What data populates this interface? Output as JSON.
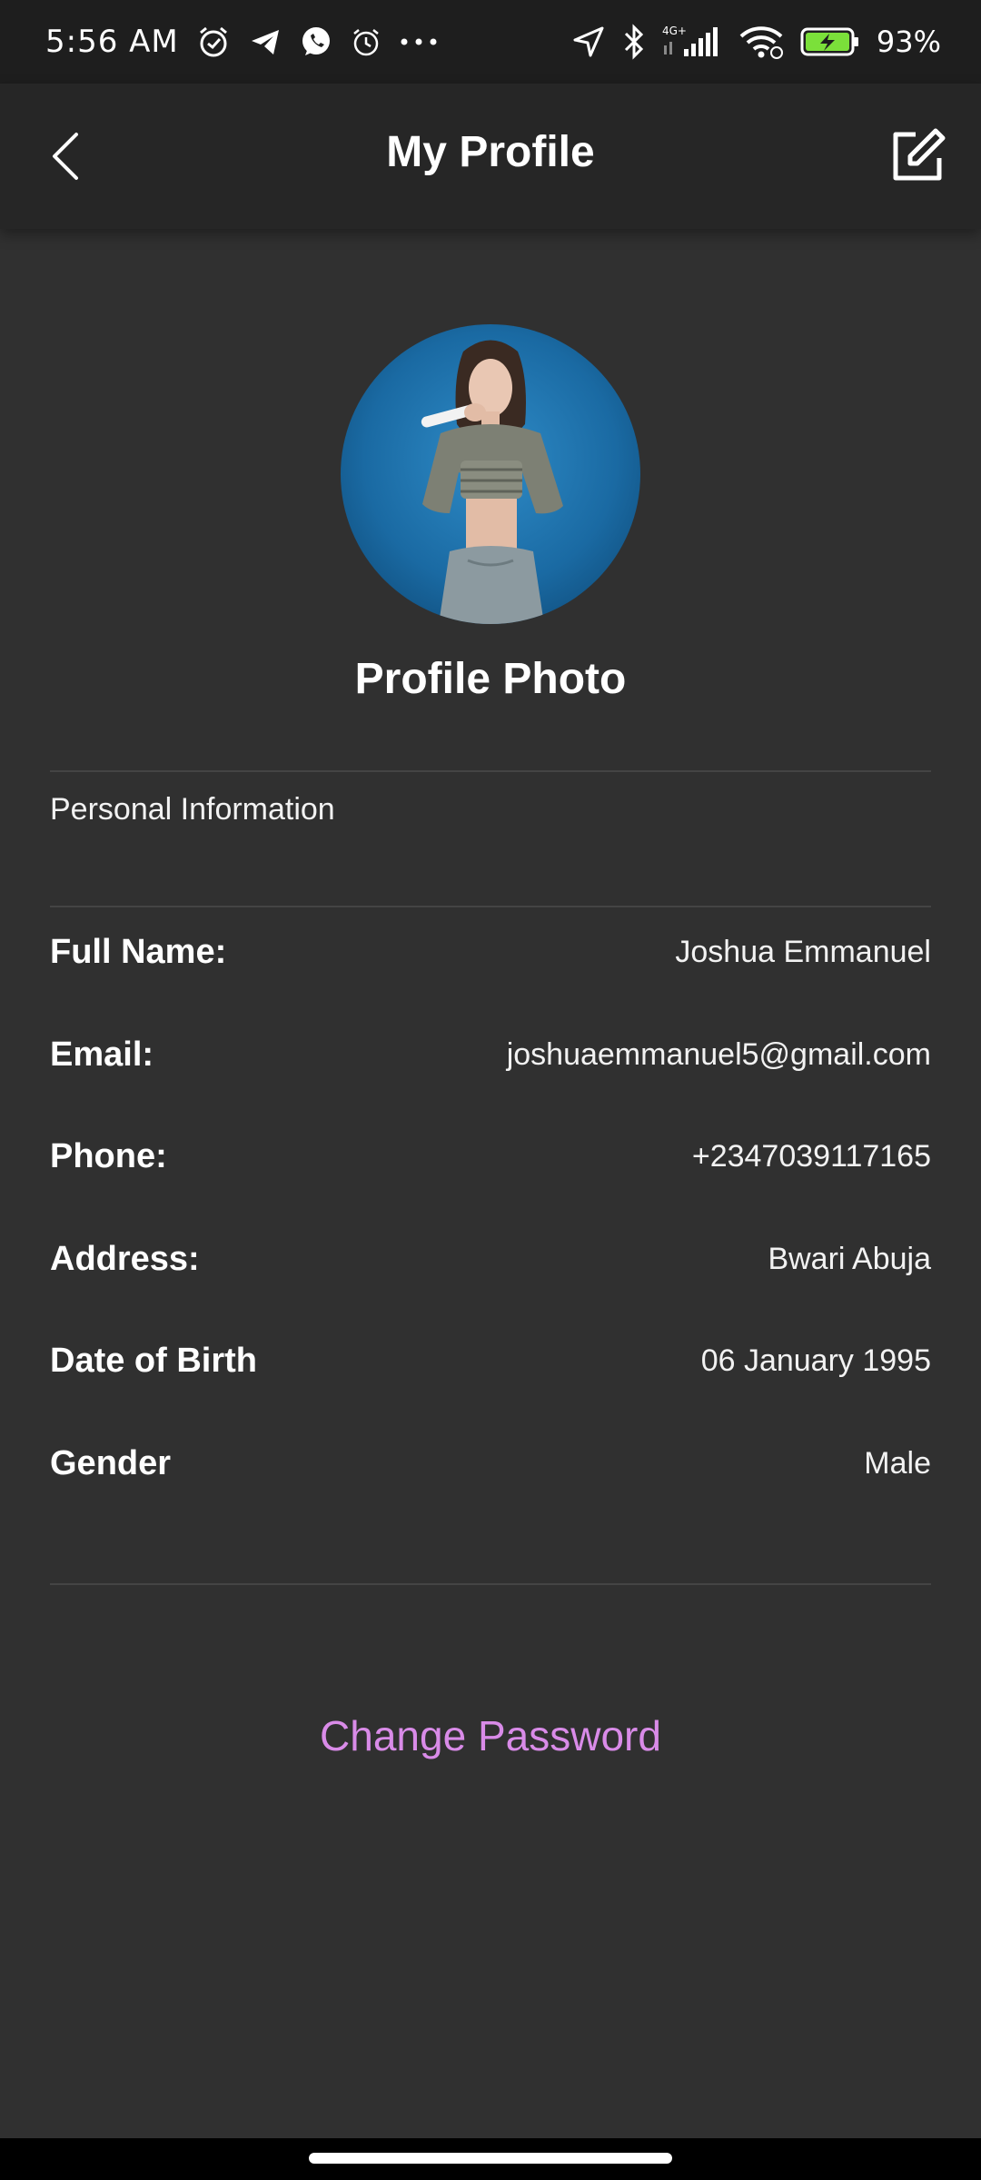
{
  "status_bar": {
    "time": "5:56 AM",
    "battery_percent": "93%",
    "icons": [
      "alarm-icon",
      "telegram-icon",
      "whatsapp-icon",
      "alarm-icon",
      "more-icon",
      "location-icon",
      "bluetooth-icon",
      "signal-icon",
      "wifi-icon",
      "battery-icon"
    ],
    "network_label": "4G+"
  },
  "app_bar": {
    "title": "My Profile",
    "back_icon": "chevron-left-icon",
    "edit_icon": "edit-icon"
  },
  "profile": {
    "photo_label": "Profile Photo"
  },
  "personal_info": {
    "section_title": "Personal Information",
    "rows": [
      {
        "label": "Full Name:",
        "value": "Joshua Emmanuel"
      },
      {
        "label": "Email:",
        "value": "joshuaemmanuel5@gmail.com"
      },
      {
        "label": "Phone:",
        "value": "+2347039117165"
      },
      {
        "label": "Address:",
        "value": "Bwari Abuja"
      },
      {
        "label": "Date of Birth",
        "value": "06 January 1995"
      },
      {
        "label": "Gender",
        "value": "Male"
      }
    ]
  },
  "actions": {
    "change_password": "Change Password"
  },
  "colors": {
    "background": "#303030",
    "app_bar": "#262626",
    "accent": "#d98be8",
    "battery": "#7be03a"
  }
}
